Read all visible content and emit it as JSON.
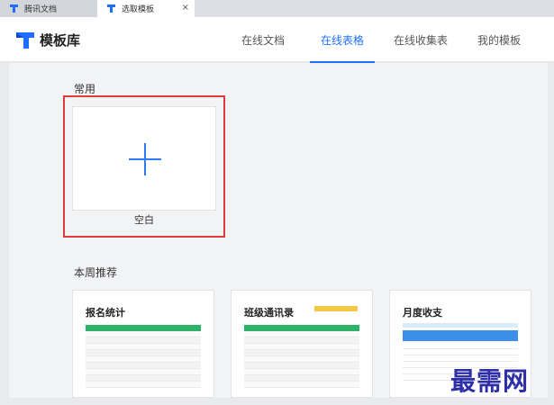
{
  "tabs": [
    {
      "label": "腾讯文档"
    },
    {
      "label": "选取模板",
      "close": "×"
    }
  ],
  "header": {
    "brand": "模板库",
    "nav": [
      "在线文档",
      "在线表格",
      "在线收集表",
      "我的模板"
    ],
    "active_nav": "在线表格"
  },
  "sections": {
    "common": "常用",
    "weekly": "本周推荐"
  },
  "blank": {
    "label": "空白"
  },
  "templates": [
    {
      "title": "报名统计"
    },
    {
      "title": "班级通讯录"
    },
    {
      "title": "月度收支"
    }
  ],
  "watermark": "最需网",
  "colors": {
    "accent": "#1e6fff",
    "highlight": "#e23b3b",
    "sheet_green": "#2fb26a"
  }
}
